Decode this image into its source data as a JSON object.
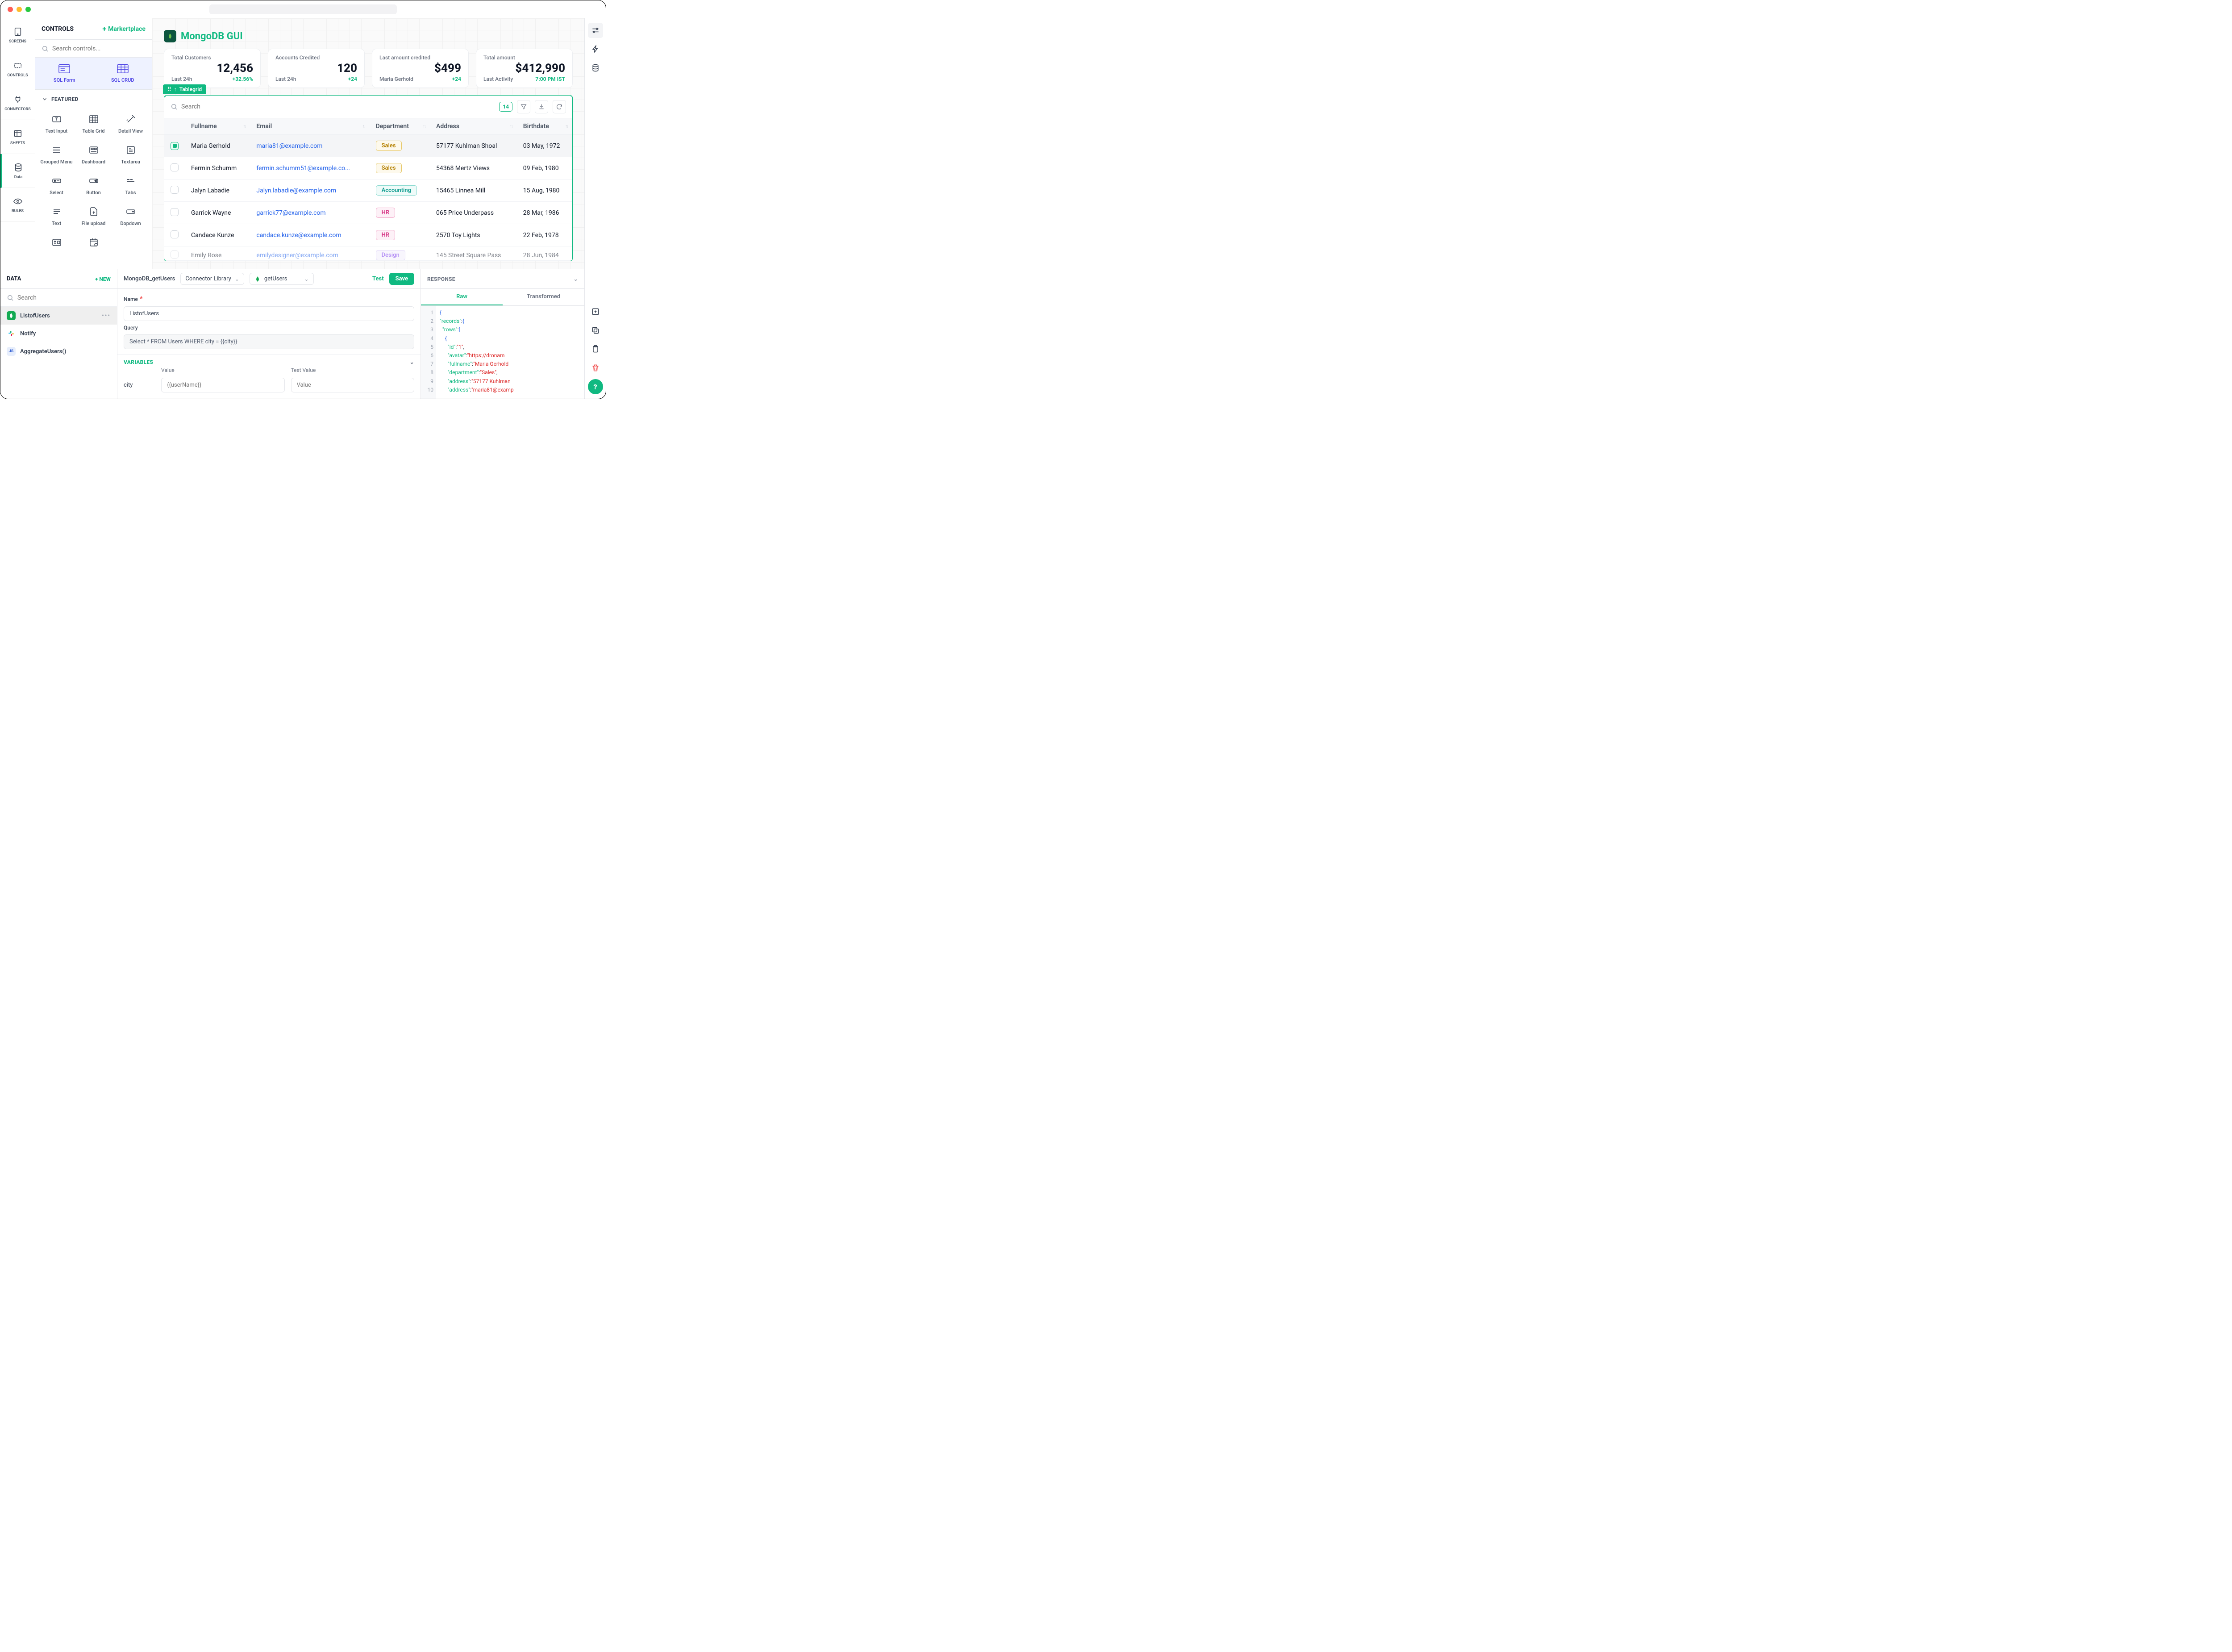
{
  "nav": {
    "screens": "SCREENS",
    "controls": "CONTROLS",
    "connectors": "CONNECTORS",
    "sheets": "SHEETS",
    "data": "Data",
    "rules": "RULES"
  },
  "controls_panel": {
    "title": "CONTROLS",
    "marketplace": "Markertplace",
    "search_placeholder": "Search controls...",
    "sql_form": "SQL Form",
    "sql_crud": "SQL CRUD",
    "featured": "FEATURED",
    "items": {
      "text_input": "Text Input",
      "table_grid": "Table Grid",
      "detail_view": "Detail View",
      "grouped_menu": "Grouped Menu",
      "dashboard": "Dashboard",
      "textarea": "Textarea",
      "select": "Select",
      "button": "Button",
      "tabs": "Tabs",
      "text": "Text",
      "file_upload": "File upload",
      "dropdown": "Dopdown"
    }
  },
  "app": {
    "title": "MongoDB GUI",
    "kpis": [
      {
        "label": "Total Customers",
        "value": "12,456",
        "sub": "Last 24h",
        "delta": "+32.56%"
      },
      {
        "label": "Accounts Credited",
        "value": "120",
        "sub": "Last 24h",
        "delta": "+24"
      },
      {
        "label": "Last amount credited",
        "value": "$499",
        "sub": "Maria Gerhold",
        "delta": "+24"
      },
      {
        "label": "Total amount",
        "value": "$412,990",
        "sub": "Last Activity",
        "delta": "7:00 PM IST"
      }
    ],
    "tablegrid": {
      "tag": "Tablegrid",
      "search_placeholder": "Search",
      "count": "14",
      "cols": {
        "fullname": "Fullname",
        "email": "Email",
        "department": "Department",
        "address": "Address",
        "birthdate": "Birthdate"
      },
      "rows": [
        {
          "name": "Maria Gerhold",
          "email": "maria81@example.com",
          "dept": "Sales",
          "dept_cls": "sales",
          "addr": "57177 Kuhlman Shoal",
          "dob": "03 May, 1972",
          "sel": true
        },
        {
          "name": "Fermin Schumm",
          "email": "fermin.schumm51@example.co...",
          "dept": "Sales",
          "dept_cls": "sales",
          "addr": "54368 Mertz Views",
          "dob": "09 Feb, 1980"
        },
        {
          "name": "Jalyn Labadie",
          "email": "Jalyn.labadie@example.com",
          "dept": "Accounting",
          "dept_cls": "acc",
          "addr": "15465 Linnea Mill",
          "dob": "15 Aug, 1980"
        },
        {
          "name": "Garrick Wayne",
          "email": "garrick77@example.com",
          "dept": "HR",
          "dept_cls": "hr",
          "addr": "065 Price Underpass",
          "dob": "28 Mar, 1986"
        },
        {
          "name": "Candace Kunze",
          "email": "candace.kunze@example.com",
          "dept": "HR",
          "dept_cls": "hr",
          "addr": "2570 Toy Lights",
          "dob": "22 Feb, 1978"
        },
        {
          "name": "Emily Rose",
          "email": "emilydesigner@example.com",
          "dept": "Design",
          "dept_cls": "design",
          "addr": "145 Street Square Pass",
          "dob": "28 Jun, 1984",
          "cut": true
        }
      ]
    }
  },
  "data_panel": {
    "title": "DATA",
    "new": "NEW",
    "search_placeholder": "Search",
    "items": {
      "listofusers": "ListofUsers",
      "notify": "Notify",
      "aggregate": "AggregateUsers()"
    }
  },
  "query": {
    "source": "MongoDB_getUsers",
    "library": "Connector Library",
    "action": "getUsers",
    "test": "Test",
    "save": "Save",
    "name_label": "Name",
    "name_value": "ListofUsers",
    "query_label": "Query",
    "query_value": "Select * FROM Users WHERE city = {{city}}",
    "vars_title": "VARIABLES",
    "vars_cols": {
      "value": "Value",
      "test": "Test Value"
    },
    "var_name": "city",
    "var_value_placeholder": "{{userName}}",
    "var_test_placeholder": "Value"
  },
  "response": {
    "title": "RESPONSE",
    "raw": "Raw",
    "transformed": "Transformed",
    "lines": [
      "1",
      "2",
      "3",
      "4",
      "5",
      "6",
      "7",
      "8",
      "9",
      "10"
    ],
    "json": {
      "l1": "{",
      "l2": "  \"records\":{",
      "l3": "    \"rows\":[",
      "l4": "      {",
      "l5_k": "\"id\"",
      "l5_v": "\"1\"",
      "l6_k": "\"avatar\"",
      "l6_v": "\"https://dronam",
      "l7_k": "\"fullname\"",
      "l7_v": "\"Maria Gerhold",
      "l8_k": "\"department\"",
      "l8_v": "\"Sales\"",
      "l9_k": "\"address\"",
      "l9_v": "\"57177 Kuhlman",
      "l10_k": "\"address\"",
      "l10_v": "\"maria81@examp"
    }
  }
}
